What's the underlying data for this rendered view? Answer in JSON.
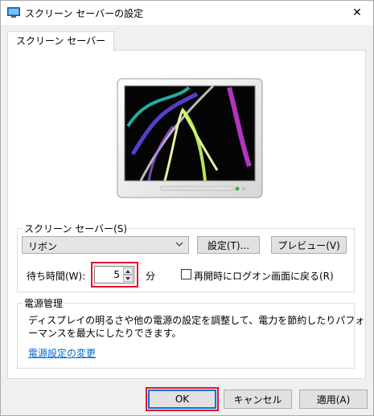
{
  "window": {
    "title": "スクリーン セーバーの設定",
    "close_glyph": "✕"
  },
  "tab": {
    "label": "スクリーン セーバー"
  },
  "screensaver": {
    "group_label": "スクリーン セーバー(S)",
    "selected": "リボン",
    "settings_label": "設定(T)...",
    "preview_label": "プレビュー(V)"
  },
  "wait": {
    "label": "待ち時間(W):",
    "value": "5",
    "unit": "分",
    "resume_label": "再開時にログオン画面に戻る(R)",
    "resume_checked": false
  },
  "power": {
    "group_label": "電源管理",
    "description_line1": "ディスプレイの明るさや他の電源の設定を調整して、電力を節約したりパフォ",
    "description_line2": "ーマンスを最大にしたりできます。",
    "link_label": "電源設定の変更"
  },
  "buttons": {
    "ok": "OK",
    "cancel": "キャンセル",
    "apply": "適用(A)"
  },
  "colors": {
    "highlight": "#e8112d",
    "link": "#0066cc",
    "focus": "#0078d7"
  },
  "icons": {
    "title": "monitor-icon",
    "close": "close-icon",
    "dropdown": "chevron-down-icon",
    "spin_up": "spin-up-icon",
    "spin_down": "spin-down-icon"
  }
}
